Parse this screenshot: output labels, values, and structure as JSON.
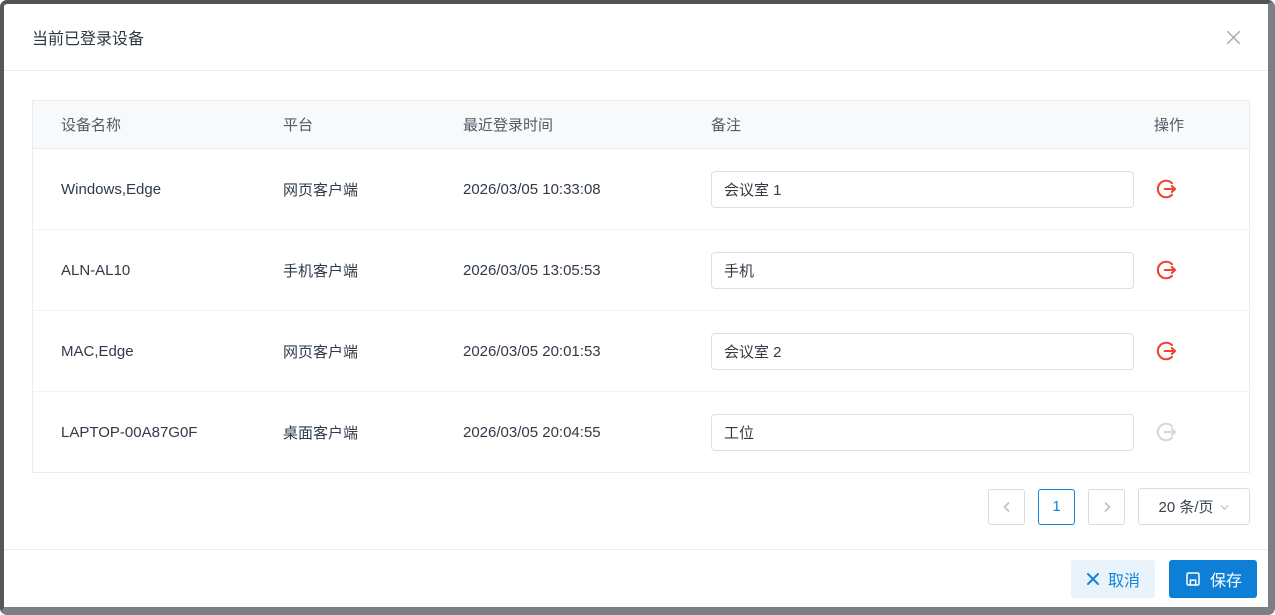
{
  "dialog": {
    "title": "当前已登录设备"
  },
  "table": {
    "columns": [
      "设备名称",
      "平台",
      "最近登录时间",
      "备注",
      "操作"
    ],
    "rows": [
      {
        "device": "Windows,Edge",
        "platform": "网页客户端",
        "last_login": "2026/03/05 10:33:08",
        "remark": "会议室 1",
        "logout_enabled": true
      },
      {
        "device": "ALN-AL10",
        "platform": "手机客户端",
        "last_login": "2026/03/05 13:05:53",
        "remark": "手机",
        "logout_enabled": true
      },
      {
        "device": "MAC,Edge",
        "platform": "网页客户端",
        "last_login": "2026/03/05 20:01:53",
        "remark": "会议室 2",
        "logout_enabled": true
      },
      {
        "device": "LAPTOP-00A87G0F",
        "platform": "桌面客户端",
        "last_login": "2026/03/05 20:04:55",
        "remark": "工位",
        "logout_enabled": false
      }
    ]
  },
  "pagination": {
    "current_page": "1",
    "page_size_label": "20 条/页"
  },
  "footer": {
    "cancel_label": "取消",
    "save_label": "保存"
  },
  "icons": {
    "close": "x-cross",
    "logout": "arrow-right-out-of-circle",
    "cancel": "x-cross",
    "save": "floppy-disk",
    "prev": "chevron-left",
    "next": "chevron-right",
    "page_size_caret": "chevron-down"
  },
  "colors": {
    "accent_blue": "#1583d7",
    "save_button_bg": "#0e7fd7",
    "cancel_button_bg": "#e9f3fc",
    "danger_red": "#f0432c",
    "disabled_gray": "#d4d7dc",
    "header_row_bg": "#f8f9fb"
  }
}
